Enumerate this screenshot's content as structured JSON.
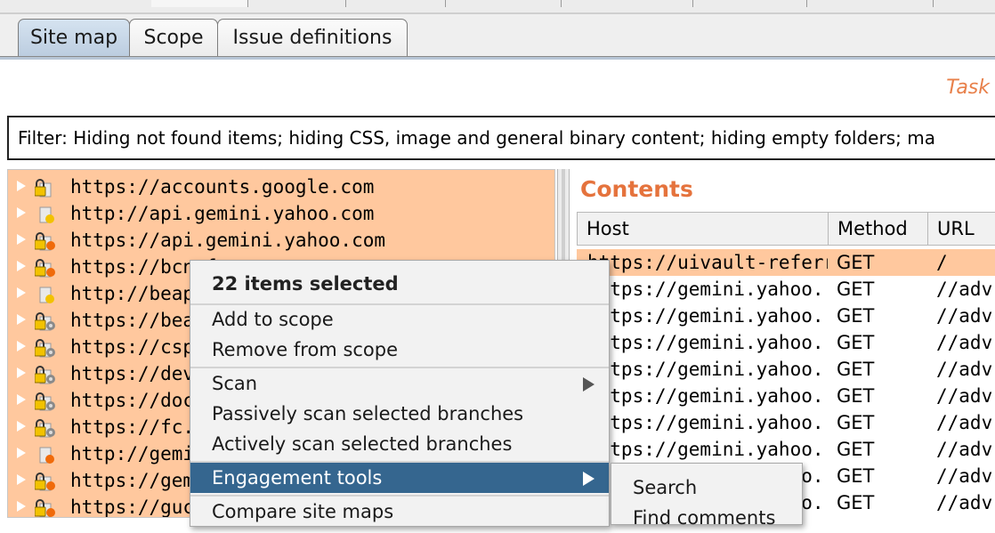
{
  "subtabs": [
    "Site map",
    "Scope",
    "Issue definitions"
  ],
  "task_link": "Task",
  "filter_text": "Filter: Hiding not found items;  hiding CSS, image and general binary content;  hiding empty folders;  ma",
  "tree": [
    {
      "label": "https://accounts.google.com",
      "icon": "lock-icon"
    },
    {
      "label": "http://api.gemini.yahoo.com",
      "icon": "page-icon"
    },
    {
      "label": "https://api.gemini.yahoo.com",
      "icon": "lock-issue-icon"
    },
    {
      "label": "https://bcn.f",
      "icon": "lock-issue-icon"
    },
    {
      "label": "http://beap.",
      "icon": "page-icon"
    },
    {
      "label": "https://beap",
      "icon": "lock-gear-icon"
    },
    {
      "label": "https://csp.",
      "icon": "lock-gear-icon"
    },
    {
      "label": "https://deve",
      "icon": "lock-gear-icon"
    },
    {
      "label": "https://docs",
      "icon": "lock-gear-icon"
    },
    {
      "label": "https://fc.ya",
      "icon": "lock-gear-icon"
    },
    {
      "label": "http://gemin",
      "icon": "page-issue-icon"
    },
    {
      "label": "https://gem",
      "icon": "lock-issue-icon"
    },
    {
      "label": "https://guce",
      "icon": "lock-issue-icon"
    }
  ],
  "contents": {
    "title": "Contents",
    "columns": [
      "Host",
      "Method",
      "URL"
    ],
    "rows": [
      {
        "host": "https://uivault-referr...",
        "method": "GET",
        "url": "/"
      },
      {
        "host": "https://gemini.yahoo....",
        "method": "GET",
        "url": "//adv"
      },
      {
        "host": "https://gemini.yahoo....",
        "method": "GET",
        "url": "//adv"
      },
      {
        "host": "https://gemini.yahoo....",
        "method": "GET",
        "url": "//adv"
      },
      {
        "host": "https://gemini.yahoo....",
        "method": "GET",
        "url": "//adv"
      },
      {
        "host": "https://gemini.yahoo....",
        "method": "GET",
        "url": "//adv"
      },
      {
        "host": "https://gemini.yahoo....",
        "method": "GET",
        "url": "//adv"
      },
      {
        "host": "https://gemini.yahoo....",
        "method": "GET",
        "url": "//adv"
      },
      {
        "host": "https://gemini.yahoo....",
        "method": "GET",
        "url": "//adv"
      },
      {
        "host": "https://gemini.yahoo....",
        "method": "GET",
        "url": "//adv"
      }
    ]
  },
  "context_menu": {
    "header": "22 items selected",
    "items": [
      "Add to scope",
      "Remove from scope",
      "Scan",
      "Passively scan selected branches",
      "Actively scan selected branches",
      "Engagement tools",
      "Compare site maps"
    ]
  },
  "submenu": {
    "items": [
      "Search",
      "Find comments"
    ]
  }
}
